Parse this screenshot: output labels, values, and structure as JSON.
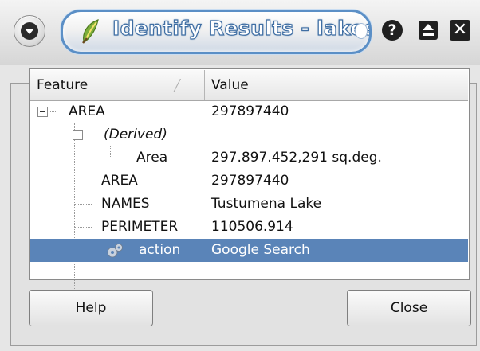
{
  "window": {
    "title": "Identify Results - lakes",
    "help_glyph": "?",
    "close_glyph": "✕"
  },
  "tree": {
    "columns": [
      "Feature",
      "Value"
    ],
    "rows": [
      {
        "feature": "AREA",
        "value": "297897440"
      },
      {
        "feature": "(Derived)",
        "value": ""
      },
      {
        "feature": "Area",
        "value": "297.897.452,291 sq.deg."
      },
      {
        "feature": "AREA",
        "value": "297897440"
      },
      {
        "feature": "NAMES",
        "value": "Tustumena Lake"
      },
      {
        "feature": "PERIMETER",
        "value": "110506.914"
      },
      {
        "feature": "action",
        "value": "Google Search",
        "selected": true
      }
    ]
  },
  "buttons": {
    "help": "Help",
    "close": "Close"
  },
  "colors": {
    "selection": "#5a84b8",
    "title_border": "#5b8fc6"
  }
}
